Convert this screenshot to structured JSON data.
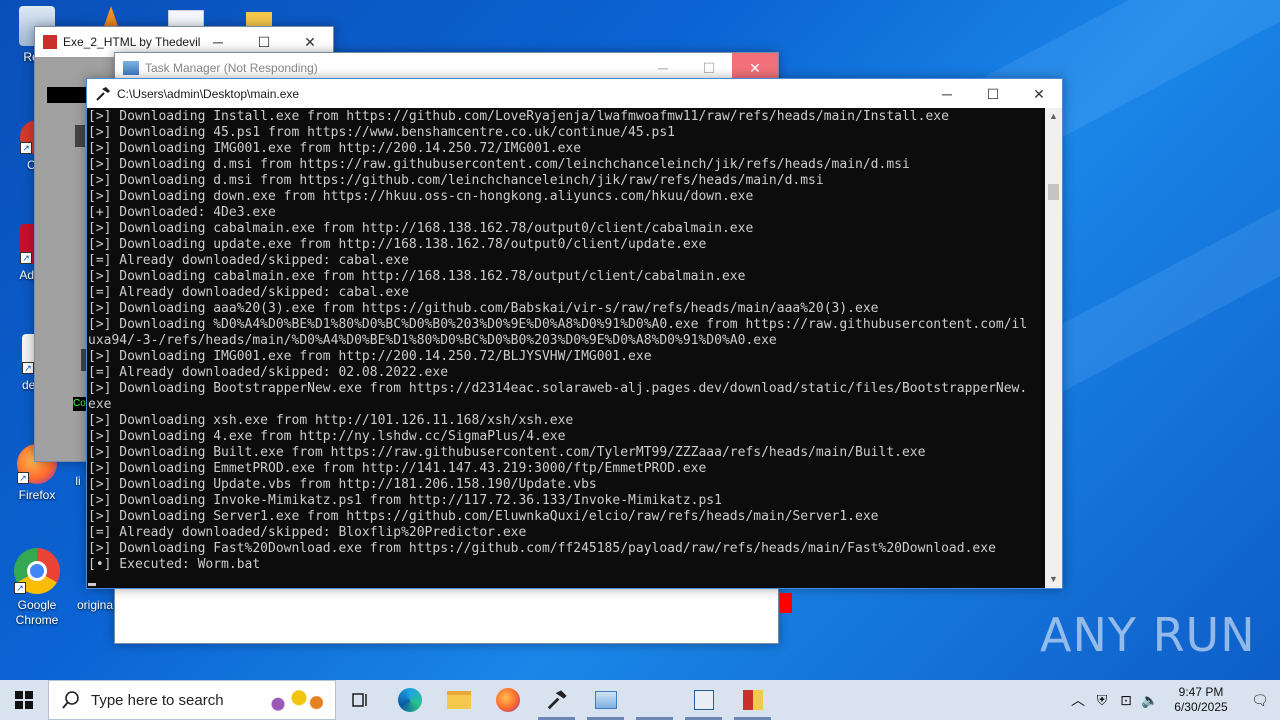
{
  "desktop": {
    "icons": [
      {
        "label": "Recy"
      },
      {
        "label": "CCl"
      },
      {
        "label": "Ad Acr"
      },
      {
        "label": "dema"
      },
      {
        "label": "Firefox"
      },
      {
        "label": "li"
      },
      {
        "label": "Google Chrome"
      },
      {
        "label": "origina"
      }
    ]
  },
  "windows": {
    "exe2html": {
      "title": "Exe_2_HTML by Thedevil"
    },
    "taskmgr": {
      "title": "Task Manager (Not Responding)"
    },
    "console": {
      "title": "C:\\Users\\admin\\Desktop\\main.exe",
      "lines": [
        "[>] Downloading Install.exe from https://github.com/LoveRyajenja/lwafmwoafmw11/raw/refs/heads/main/Install.exe",
        "[>] Downloading 45.ps1 from https://www.benshamcentre.co.uk/continue/45.ps1",
        "[>] Downloading IMG001.exe from http://200.14.250.72/IMG001.exe",
        "[>] Downloading d.msi from https://raw.githubusercontent.com/leinchchanceleinch/jik/refs/heads/main/d.msi",
        "[>] Downloading d.msi from https://github.com/leinchchanceleinch/jik/raw/refs/heads/main/d.msi",
        "[>] Downloading down.exe from https://hkuu.oss-cn-hongkong.aliyuncs.com/hkuu/down.exe",
        "[+] Downloaded: 4De3.exe",
        "[>] Downloading cabalmain.exe from http://168.138.162.78/output0/client/cabalmain.exe",
        "[>] Downloading update.exe from http://168.138.162.78/output0/client/update.exe",
        "[=] Already downloaded/skipped: cabal.exe",
        "[>] Downloading cabalmain.exe from http://168.138.162.78/output/client/cabalmain.exe",
        "[=] Already downloaded/skipped: cabal.exe",
        "[>] Downloading aaa%20(3).exe from https://github.com/Babskai/vir-s/raw/refs/heads/main/aaa%20(3).exe",
        "[>] Downloading %D0%A4%D0%BE%D1%80%D0%BC%D0%B0%203%D0%9E%D0%A8%D0%91%D0%A0.exe from https://raw.githubusercontent.com/il",
        "uxa94/-3-/refs/heads/main/%D0%A4%D0%BE%D1%80%D0%BC%D0%B0%203%D0%9E%D0%A8%D0%91%D0%A0.exe",
        "[>] Downloading IMG001.exe from http://200.14.250.72/BLJYSVHW/IMG001.exe",
        "[=] Already downloaded/skipped: 02.08.2022.exe",
        "[>] Downloading BootstrapperNew.exe from https://d2314eac.solaraweb-alj.pages.dev/download/static/files/BootstrapperNew.",
        "exe",
        "[>] Downloading xsh.exe from http://101.126.11.168/xsh/xsh.exe",
        "[>] Downloading 4.exe from http://ny.lshdw.cc/SigmaPlus/4.exe",
        "[>] Downloading Built.exe from https://raw.githubusercontent.com/TylerMT99/ZZZaaa/refs/heads/main/Built.exe",
        "[>] Downloading EmmetPROD.exe from http://141.147.43.219:3000/ftp/EmmetPROD.exe",
        "[>] Downloading Update.vbs from http://181.206.158.190/Update.vbs",
        "[>] Downloading Invoke-Mimikatz.ps1 from http://117.72.36.133/Invoke-Mimikatz.ps1",
        "[>] Downloading Server1.exe from https://github.com/EluwnkaQuxi/elcio/raw/refs/heads/main/Server1.exe",
        "[=] Already downloaded/skipped: Bloxflip%20Predictor.exe",
        "[>] Downloading Fast%20Download.exe from https://github.com/ff245185/payload/raw/refs/heads/main/Fast%20Download.exe",
        "[•] Executed: Worm.bat"
      ]
    }
  },
  "taskbar": {
    "search_placeholder": "Type here to search",
    "time": "9:47 PM",
    "date": "6/30/2025"
  },
  "watermark": "ANY RUN",
  "colors": {
    "desktop": "#0b63d3",
    "console_bg": "#0c0c0c",
    "console_text": "#cccccc",
    "close_hover": "#e81123"
  }
}
